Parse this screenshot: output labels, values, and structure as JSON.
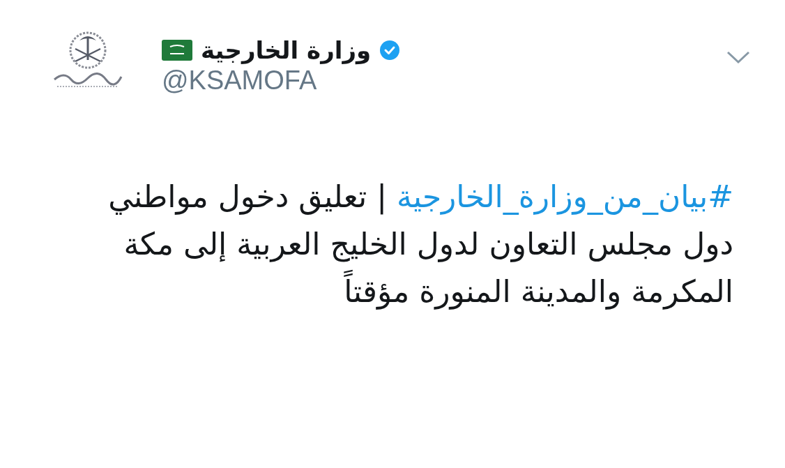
{
  "author": {
    "name": "وزارة الخارجية",
    "handle": "@KSAMOFA",
    "verified": true
  },
  "tweet": {
    "hashtag": "#بيان_من_وزارة_الخارجية",
    "text": " | تعليق دخول مواطني دول مجلس التعاون لدول الخليج العربية إلى مكة المكرمة والمدينة المنورة مؤقتاً"
  }
}
